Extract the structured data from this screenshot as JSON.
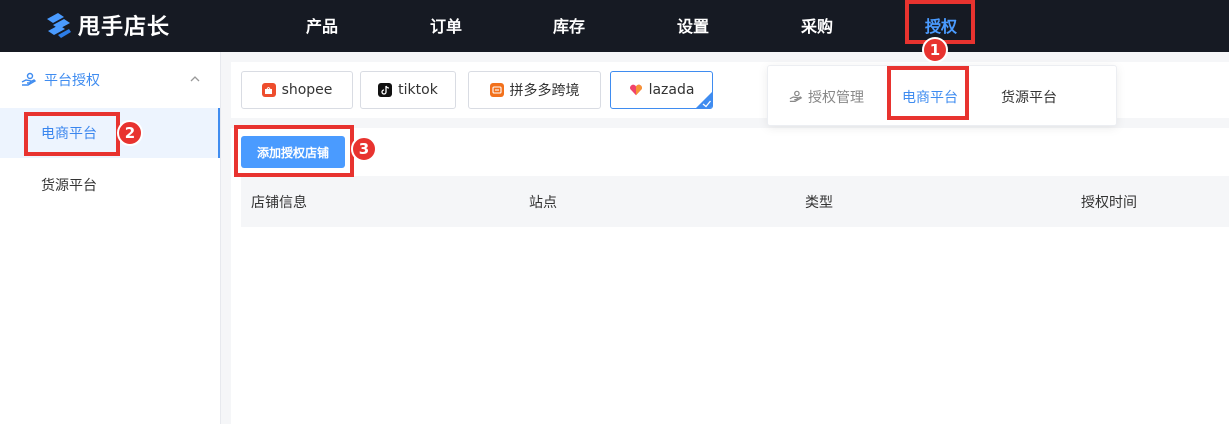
{
  "app": {
    "title": "甩手店长"
  },
  "nav": {
    "items": [
      {
        "label": "产品"
      },
      {
        "label": "订单"
      },
      {
        "label": "库存"
      },
      {
        "label": "设置"
      },
      {
        "label": "采购"
      },
      {
        "label": "授权",
        "active": true
      }
    ]
  },
  "sidebar": {
    "group": {
      "label": "平台授权"
    },
    "items": [
      {
        "label": "电商平台",
        "active": true
      },
      {
        "label": "货源平台"
      }
    ]
  },
  "platforms": [
    {
      "label": "shopee",
      "icon": "shopee-icon"
    },
    {
      "label": "tiktok",
      "icon": "tiktok-icon"
    },
    {
      "label": "拼多多跨境",
      "icon": "pinduoduo-icon"
    },
    {
      "label": "lazada",
      "icon": "lazada-icon",
      "active": true
    }
  ],
  "actions": {
    "add_shop": "添加授权店铺"
  },
  "table": {
    "columns": [
      "店铺信息",
      "站点",
      "类型",
      "授权时间"
    ]
  },
  "dropdown": {
    "items": [
      {
        "label": "授权管理",
        "icon": "hand-icon"
      },
      {
        "label": "电商平台",
        "active": true
      },
      {
        "label": "货源平台"
      }
    ]
  },
  "annotations": {
    "badges": [
      "1",
      "2",
      "3"
    ]
  },
  "colors": {
    "topbar": "#161a23",
    "accent": "#3f8cf0",
    "highlight": "#e8332f",
    "button": "#4a9bff"
  }
}
